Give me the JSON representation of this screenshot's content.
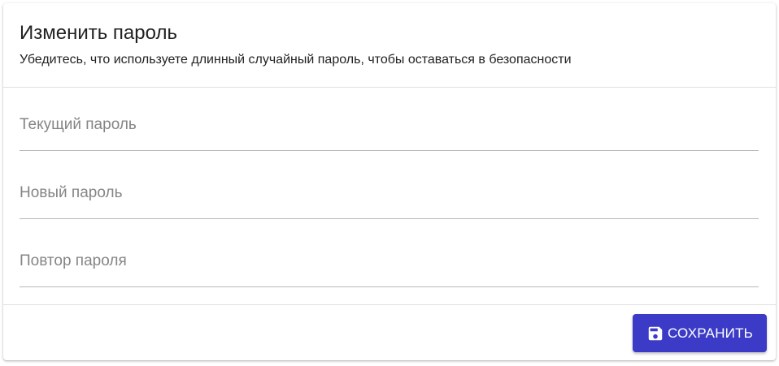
{
  "header": {
    "title": "Изменить пароль",
    "subtitle": "Убедитесь, что используете длинный случайный пароль, чтобы оставаться в безопасности"
  },
  "form": {
    "fields": [
      {
        "placeholder": "Текущий пароль",
        "value": ""
      },
      {
        "placeholder": "Новый пароль",
        "value": ""
      },
      {
        "placeholder": "Повтор пароля",
        "value": ""
      }
    ]
  },
  "footer": {
    "save_label": "СОХРАНИТЬ",
    "save_icon": "save-icon"
  },
  "colors": {
    "accent": "#3b3bc7",
    "text": "#222222",
    "placeholder": "#858585",
    "divider": "#e0e0e0",
    "underline": "#b8b8b8"
  }
}
